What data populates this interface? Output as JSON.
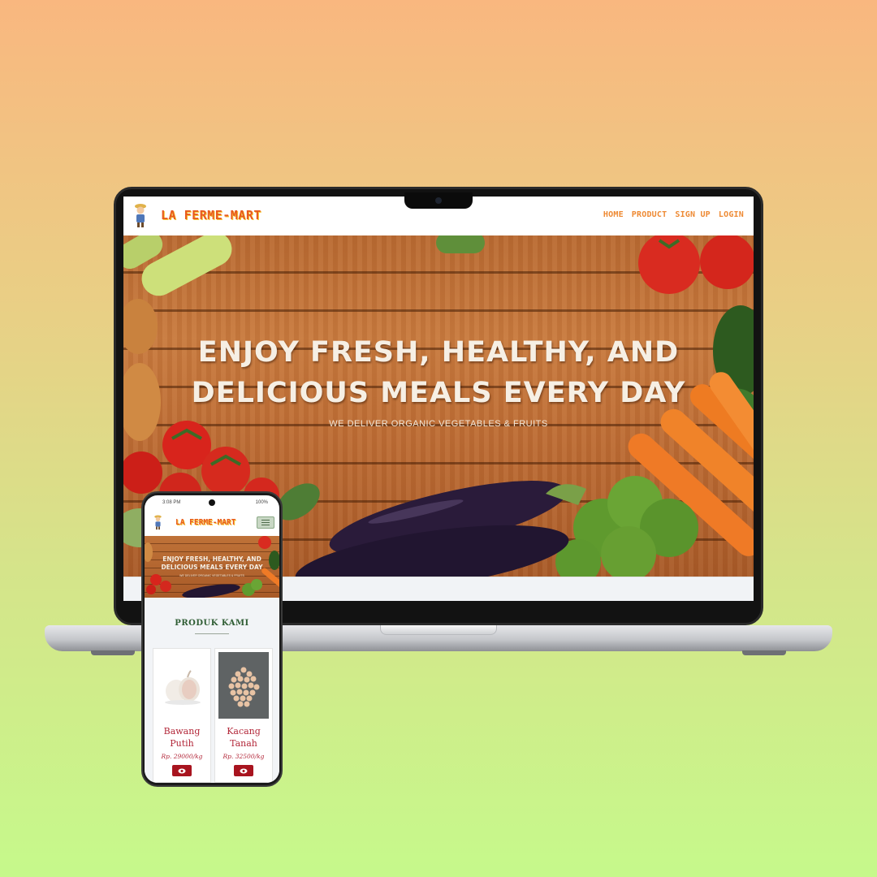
{
  "site": {
    "logo": "LA FERME-MART",
    "nav": [
      "HOME",
      "PRODUCT",
      "SIGN UP",
      "LOGIN"
    ]
  },
  "hero": {
    "title_line1": "ENJOY FRESH, HEALTHY, AND",
    "title_line2": "DELICIOUS MEALS EVERY DAY",
    "subtitle": "WE DELIVER ORGANIC VEGETABLES & FRUITS"
  },
  "phone": {
    "time": "3:08 PM",
    "battery": "100%",
    "section_title": "PRODUK KAMI",
    "products": [
      {
        "name_line1": "Bawang",
        "name_line2": "Putih",
        "price": "Rp. 29000/kg",
        "icon": "eye-icon"
      },
      {
        "name_line1": "Kacang",
        "name_line2": "Tanah",
        "price": "Rp. 32500/kg",
        "icon": "eye-icon"
      }
    ]
  },
  "colors": {
    "logo": "#e85a1e",
    "nav": "#ee8a34",
    "product_text": "#b3283a",
    "button": "#a8141f",
    "section_title": "#2f5d34"
  }
}
